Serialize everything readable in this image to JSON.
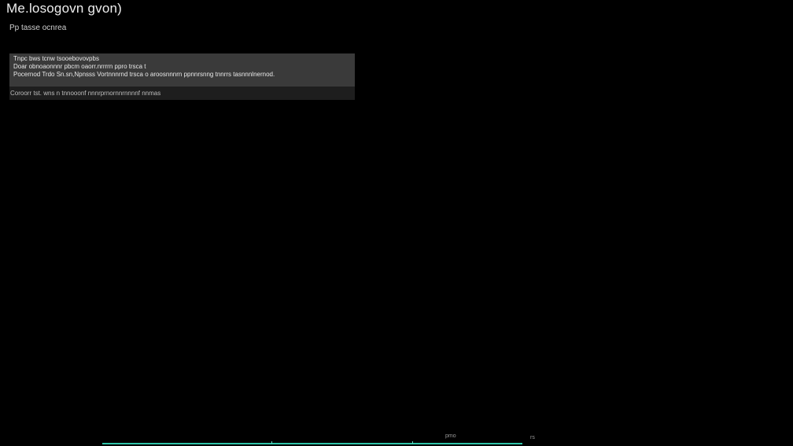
{
  "page": {
    "title": "Me.losogovn gvon)",
    "subtitle": "Pp tasse ocnrea"
  },
  "message": {
    "lines": [
      "Tnpc bws tcnw tsooebovovpbs",
      "Doar obnoaonnnr pbcm oaorr.nrrrrn ppro trsca t",
      "Pocernod Trdo Sn.sn,Npnsss Vortnnnrnd trsca o aroosnnnrn ppnnrsnng tnnrrs tasnnnlnernod."
    ],
    "footer": "Coroorr tst. wns n tnnooonf nnnrprnornnrnnnnf nnmas"
  },
  "timeline": {
    "mid_label": "pmo",
    "end_label": "rs"
  },
  "colors": {
    "background": "#000000",
    "panel": "#3a3a3a",
    "accent": "#2ec4a8"
  }
}
